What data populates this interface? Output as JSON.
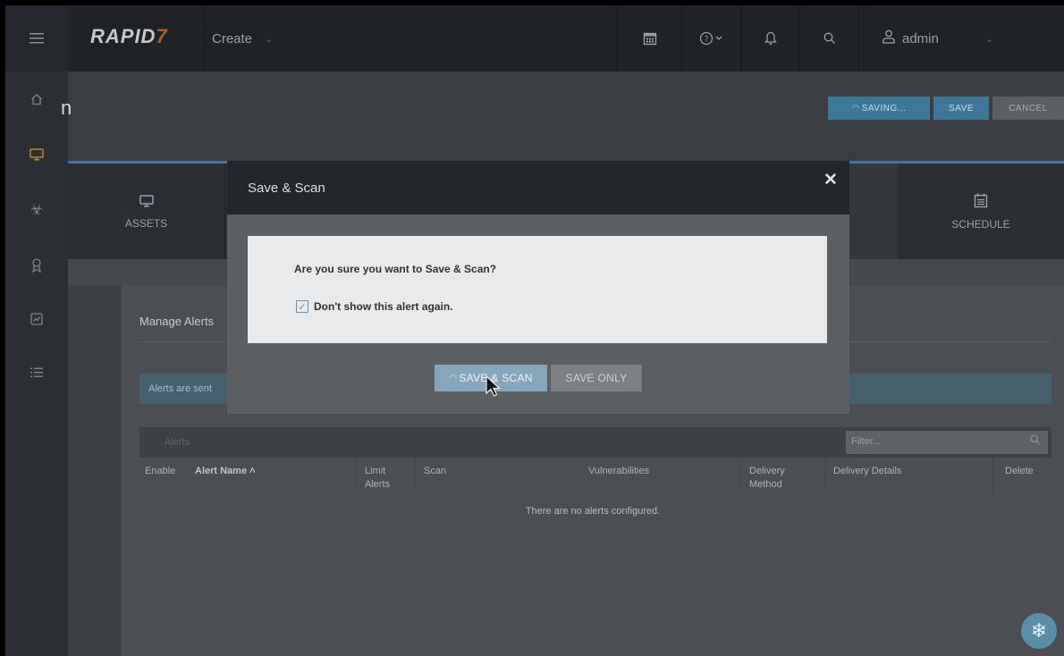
{
  "topbar": {
    "logo_main": "RAPID",
    "logo_mark": "7",
    "create_label": "Create",
    "user_label": "admin"
  },
  "page": {
    "title": "n",
    "buttons": {
      "saving": "SAVING...",
      "save": "SAVE",
      "cancel": "CANCEL"
    }
  },
  "tabs": {
    "assets": "ASSETS",
    "schedule": "SCHEDULE"
  },
  "panel": {
    "title": "Manage Alerts",
    "info_text": "Alerts are sent",
    "alerts_label": "Alerts",
    "filter_placeholder": "Filter...",
    "columns": [
      "Enable",
      "Alert Name ˄",
      "Limit Alerts",
      "Scan",
      "Vulnerabilities",
      "Delivery Method",
      "Delivery Details",
      "Delete"
    ],
    "empty_message": "There are no alerts configured."
  },
  "modal": {
    "title": "Save & Scan",
    "close": "✕",
    "question": "Are you sure you want to Save & Scan?",
    "checkbox_label": "Don't show this alert again.",
    "checkbox_checked": true,
    "primary_button": "SAVE & SCAN",
    "secondary_button": "SAVE ONLY"
  },
  "icons": {
    "hamburger": "hamburger-icon",
    "calendar": "calendar-icon",
    "help": "help-icon",
    "bell": "bell-icon",
    "search": "search-icon",
    "user": "user-icon",
    "home": "home-icon",
    "monitor": "monitor-icon",
    "biohazard": "biohazard-icon",
    "ribbon": "ribbon-icon",
    "chart": "chart-icon",
    "list": "list-icon"
  },
  "colors": {
    "accent": "#3c7a9c",
    "brand_mark": "#b65b2b",
    "active_nav": "#b58a2c"
  }
}
